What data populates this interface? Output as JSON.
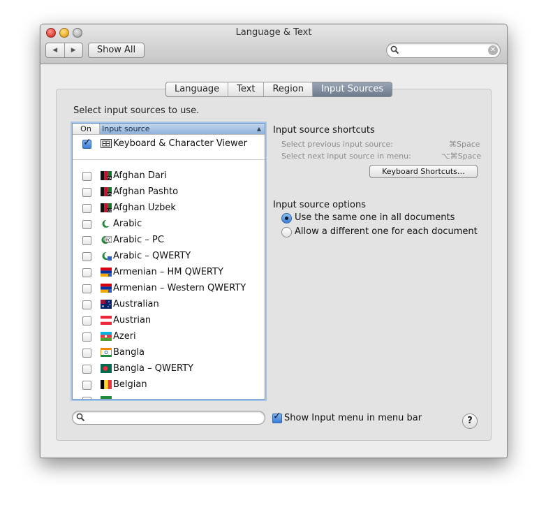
{
  "window": {
    "title": "Language & Text"
  },
  "toolbar": {
    "back_icon": "◀",
    "forward_icon": "▶",
    "show_all_label": "Show All",
    "search_value": "",
    "search_placeholder": ""
  },
  "tabs": [
    {
      "label": "Language",
      "active": false
    },
    {
      "label": "Text",
      "active": false
    },
    {
      "label": "Region",
      "active": false
    },
    {
      "label": "Input Sources",
      "active": true
    }
  ],
  "input_sources": {
    "instructions": "Select input sources to use.",
    "columns": {
      "on": "On",
      "source": "Input source"
    },
    "pinned": {
      "label": "Keyboard & Character Viewer",
      "checked": true,
      "icon": "keyboard-viewer-icon"
    },
    "items": [
      {
        "label": "Afghan Dari",
        "checked": false,
        "icon": "afghan-dari-flag-icon"
      },
      {
        "label": "Afghan Pashto",
        "checked": false,
        "icon": "afghan-pashto-flag-icon"
      },
      {
        "label": "Afghan Uzbek",
        "checked": false,
        "icon": "afghan-uzbek-flag-icon"
      },
      {
        "label": "Arabic",
        "checked": false,
        "icon": "arabic-crescent-icon"
      },
      {
        "label": "Arabic – PC",
        "checked": false,
        "icon": "arabic-pc-icon"
      },
      {
        "label": "Arabic – QWERTY",
        "checked": false,
        "icon": "arabic-qwerty-icon"
      },
      {
        "label": "Armenian – HM QWERTY",
        "checked": false,
        "icon": "armenian-flag-icon"
      },
      {
        "label": "Armenian – Western QWERTY",
        "checked": false,
        "icon": "armenian-flag-icon"
      },
      {
        "label": "Australian",
        "checked": false,
        "icon": "australian-flag-icon"
      },
      {
        "label": "Austrian",
        "checked": false,
        "icon": "austrian-flag-icon"
      },
      {
        "label": "Azeri",
        "checked": false,
        "icon": "azeri-flag-icon"
      },
      {
        "label": "Bangla",
        "checked": false,
        "icon": "bangla-icon"
      },
      {
        "label": "Bangla – QWERTY",
        "checked": false,
        "icon": "bangladesh-flag-icon"
      },
      {
        "label": "Belgian",
        "checked": false,
        "icon": "belgian-flag-icon"
      }
    ],
    "filter_value": ""
  },
  "shortcuts": {
    "heading": "Input source shortcuts",
    "rows": [
      {
        "label": "Select previous input source:",
        "keys": "⌘Space"
      },
      {
        "label": "Select next input source in menu:",
        "keys": "⌥⌘Space"
      }
    ],
    "button_label": "Keyboard Shortcuts…"
  },
  "options": {
    "heading": "Input source options",
    "choices": [
      {
        "label": "Use the same one in all documents",
        "selected": true
      },
      {
        "label": "Allow a different one for each document",
        "selected": false
      }
    ]
  },
  "footer": {
    "show_menu_label": "Show Input menu in menu bar",
    "show_menu_checked": true,
    "help_label": "?"
  }
}
